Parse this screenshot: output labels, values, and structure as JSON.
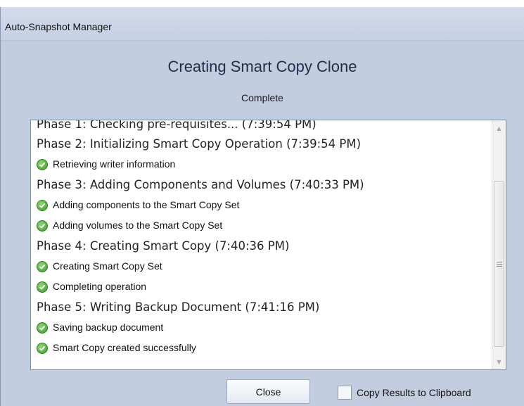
{
  "window": {
    "title": "Auto-Snapshot Manager"
  },
  "dialog": {
    "heading": "Creating Smart Copy Clone",
    "status": "Complete"
  },
  "log": {
    "phase1": "Phase 1: Checking pre-requisites... (7:39:54 PM)",
    "phase2": "Phase 2: Initializing Smart Copy Operation (7:39:54 PM)",
    "phase2_steps": [
      "Retrieving writer information"
    ],
    "phase3": "Phase 3: Adding Components and Volumes (7:40:33 PM)",
    "phase3_steps": [
      "Adding components to the Smart Copy Set",
      "Adding volumes to the Smart Copy Set"
    ],
    "phase4": "Phase 4: Creating Smart Copy (7:40:36 PM)",
    "phase4_steps": [
      "Creating Smart Copy Set",
      "Completing operation"
    ],
    "phase5": "Phase 5: Writing Backup Document (7:41:16 PM)",
    "phase5_steps": [
      "Saving backup document",
      "Smart Copy created successfully"
    ],
    "step_icon": "check-circle-icon"
  },
  "buttons": {
    "close": "Close"
  },
  "clipboard": {
    "label": "Copy Results to Clipboard",
    "checked": false
  },
  "colors": {
    "success": "#3c9a2f",
    "window_bg": "#c3cde0"
  }
}
